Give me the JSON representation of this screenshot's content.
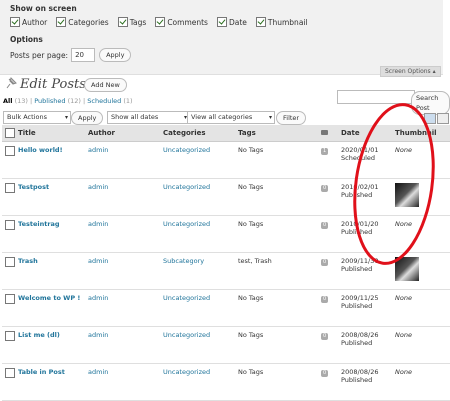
{
  "screen_options": {
    "heading": "Show on screen",
    "columns": [
      {
        "label": "Author",
        "checked": true
      },
      {
        "label": "Categories",
        "checked": true
      },
      {
        "label": "Tags",
        "checked": true
      },
      {
        "label": "Comments",
        "checked": true
      },
      {
        "label": "Date",
        "checked": true
      },
      {
        "label": "Thumbnail",
        "checked": true
      }
    ],
    "options_heading": "Options",
    "posts_per_page_label": "Posts per page:",
    "posts_per_page_value": "20",
    "apply_label": "Apply",
    "tab_label": "Screen Options ▴"
  },
  "header": {
    "title": "Edit Posts",
    "add_new_label": "Add New"
  },
  "filters": {
    "all": "All",
    "all_count": "(13)",
    "published": "Published",
    "published_count": "(12)",
    "scheduled": "Scheduled",
    "scheduled_count": "(1)",
    "bulk_actions": "Bulk Actions",
    "apply": "Apply",
    "dates": "Show all dates",
    "categories": "View all categories",
    "filter": "Filter",
    "search_button": "Search Post"
  },
  "table": {
    "headers": {
      "title": "Title",
      "author": "Author",
      "categories": "Categories",
      "tags": "Tags",
      "date": "Date",
      "thumbnail": "Thumbnail"
    },
    "rows": [
      {
        "title": "Hello world!",
        "author": "admin",
        "category": "Uncategorized",
        "tags": "No Tags",
        "comments": "1",
        "date": "2020/01/01",
        "status": "Scheduled",
        "thumbnail": "None",
        "has_thumb": false
      },
      {
        "title": "Testpost",
        "author": "admin",
        "category": "Uncategorized",
        "tags": "No Tags",
        "comments": "0",
        "date": "2010/02/01",
        "status": "Published",
        "thumbnail": "",
        "has_thumb": true
      },
      {
        "title": "Testeintrag",
        "author": "admin",
        "category": "Uncategorized",
        "tags": "No Tags",
        "comments": "0",
        "date": "2010/01/20",
        "status": "Published",
        "thumbnail": "None",
        "has_thumb": false
      },
      {
        "title": "Trash",
        "author": "admin",
        "category": "Subcategory",
        "tags": "test, Trash",
        "comments": "0",
        "date": "2009/11/30",
        "status": "Published",
        "thumbnail": "",
        "has_thumb": true
      },
      {
        "title": "Welcome to WP !",
        "author": "admin",
        "category": "Uncategorized",
        "tags": "No Tags",
        "comments": "0",
        "date": "2009/11/25",
        "status": "Published",
        "thumbnail": "None",
        "has_thumb": false
      },
      {
        "title": "List me (dl)",
        "author": "admin",
        "category": "Uncategorized",
        "tags": "No Tags",
        "comments": "0",
        "date": "2008/08/26",
        "status": "Published",
        "thumbnail": "None",
        "has_thumb": false
      },
      {
        "title": "Table in Post",
        "author": "admin",
        "category": "Uncategorized",
        "tags": "No Tags",
        "comments": "0",
        "date": "2008/08/26",
        "status": "Published",
        "thumbnail": "None",
        "has_thumb": false
      }
    ]
  },
  "colors": {
    "link": "#21759b",
    "annotation": "#e0101a"
  }
}
